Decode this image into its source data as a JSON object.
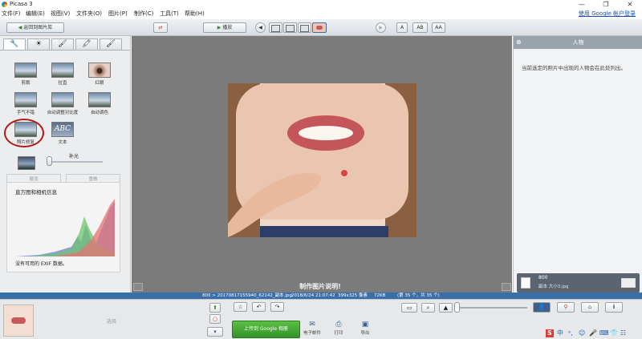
{
  "app": {
    "title": "Picasa 3"
  },
  "window_controls": {
    "minimize": "—",
    "maximize": "❐",
    "close": "✕"
  },
  "menu": {
    "items": [
      "文件(F)",
      "编辑(E)",
      "视图(V)",
      "文件夹(O)",
      "图片(P)",
      "制作(C)",
      "工具(T)",
      "帮助(H)"
    ],
    "signin": "使用 Google 帐户登录"
  },
  "toolbar": {
    "back_label": "返回到图片库",
    "play_label": "播放",
    "text_sizes": [
      "A",
      "AB",
      "AA"
    ]
  },
  "edit_tabs": [
    "🔧",
    "☀",
    "🖌",
    "🖍",
    "🖌"
  ],
  "tools": [
    {
      "label": "剪裁"
    },
    {
      "label": "拉直"
    },
    {
      "label": "红眼"
    },
    {
      "label": "手气不错"
    },
    {
      "label": "自动调整对比度"
    },
    {
      "label": "自动调色"
    },
    {
      "label": "照片修复"
    },
    {
      "label": "文本"
    }
  ],
  "fill_light": {
    "label": "补光",
    "value": 0
  },
  "undo_redo": {
    "undo": "撤消",
    "redo": "重做"
  },
  "histogram": {
    "title": "直方图和相机信息",
    "exif_note": "没有可用的 EXIF 数据。"
  },
  "caption": {
    "placeholder": "制作图片说明!"
  },
  "people_panel": {
    "title": "人物",
    "message": "当前选定的照片中出现的人物会在此处列出。",
    "thumb_title": "800",
    "thumb_sub": "副本 大小3.jpg"
  },
  "status": {
    "path": "800 > 20170817155940_62142_副本.jpg",
    "datetime": "2018/6/24 21:07:42",
    "dimensions": "399x325 像素",
    "size": "72KB",
    "position": "(第 35 个，共 35 个)"
  },
  "bottom": {
    "selected": "选择",
    "upload": "上传到 Google 相册",
    "email": "电子邮件",
    "print": "打印",
    "export": "导出"
  },
  "colors": {
    "accent": "#3a6ea8",
    "upload": "#3fa52f",
    "canvas": "#7b7b7b"
  }
}
